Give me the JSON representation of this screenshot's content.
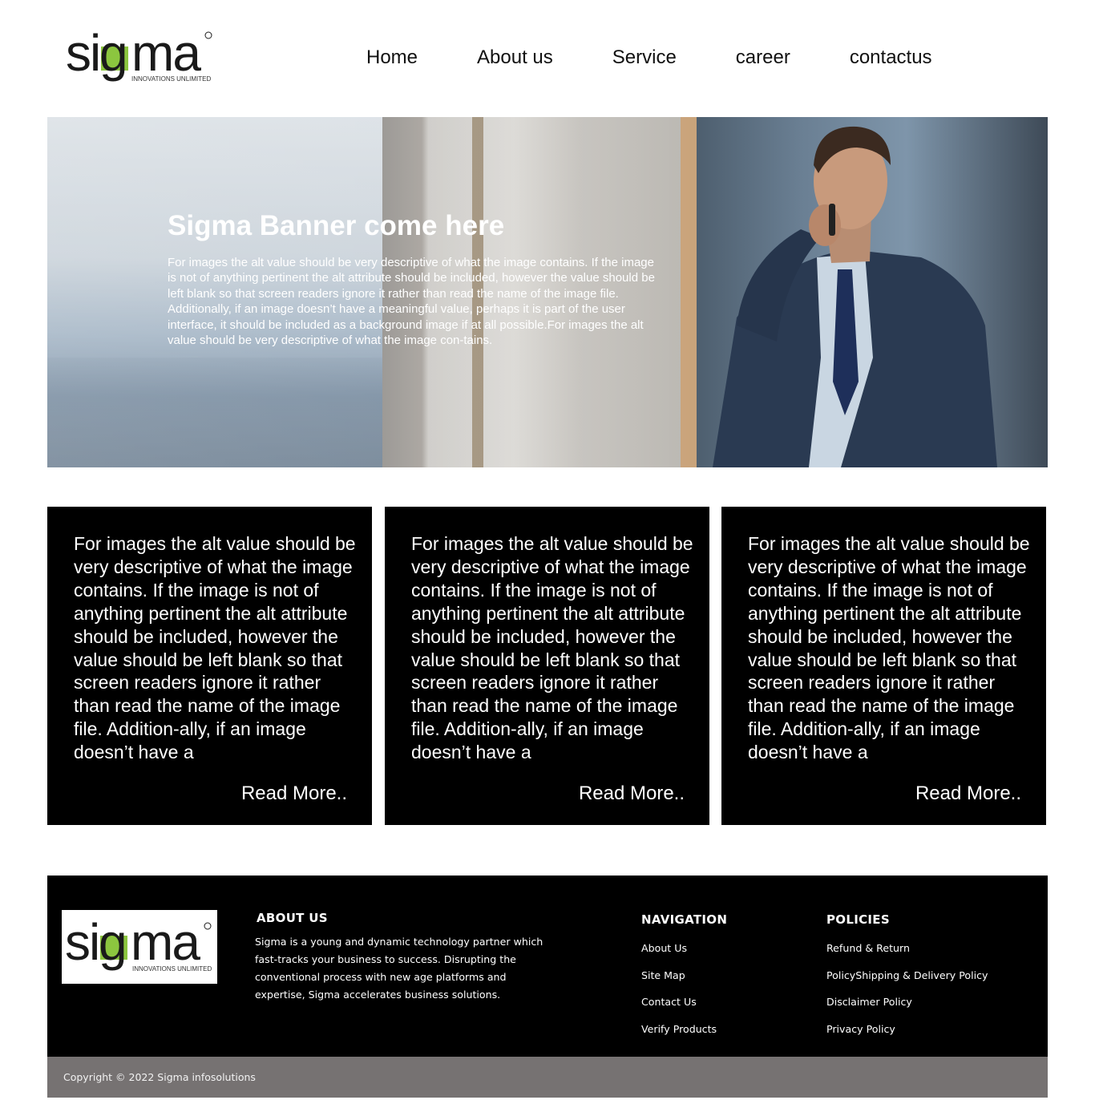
{
  "header": {
    "logo": {
      "brand": "sigma",
      "tagline": "INNOVATIONS UNLIMITED",
      "mark": "TM",
      "accent_color": "#8cc63f"
    },
    "nav": [
      {
        "label": "Home"
      },
      {
        "label": "About us"
      },
      {
        "label": "Service"
      },
      {
        "label": "career"
      },
      {
        "label": "contactus"
      }
    ]
  },
  "banner": {
    "title": "Sigma Banner come here",
    "text": "For images the alt value should be very descriptive of what the image contains. If the image is not of anything pertinent the alt attribute should be included, however the value should be left blank so that screen readers ignore it rather than read the name of the image file. Additionally, if an image doesn’t have a meaningful value, perhaps it is part of the user interface, it should be included as a background image if at all possible.For images the alt value should be very descriptive of what the image con-tains."
  },
  "cards": [
    {
      "text": "For images the alt value should be very descriptive of what the image contains. If the image is not of anything pertinent the alt attribute should be included, however the value should be left blank so that screen readers ignore it rather than read the name of the image file. Addition-ally, if an image doesn’t have a",
      "link": "Read More.."
    },
    {
      "text": "For images the alt value should be very descriptive of what the image contains. If the image is not of anything pertinent the alt attribute should be included, however the value should be left blank so that screen readers ignore it rather than read the name of the image file. Addition-ally, if an image doesn’t have a",
      "link": "Read More.."
    },
    {
      "text": "For images the alt value should be very descriptive of what the image contains. If the image is not of anything pertinent the alt attribute should be included, however the value should be left blank so that screen readers ignore it rather than read the name of the image file. Addition-ally, if an image doesn’t have a",
      "link": "Read More.."
    }
  ],
  "footer": {
    "about": {
      "heading": "ABOUT US",
      "text": "Sigma is a young and dynamic technology partner which fast-tracks your business to success. Disrupting the conventional process with new age platforms and expertise, Sigma accelerates business solutions."
    },
    "navigation": {
      "heading": "NAVIGATION",
      "links": [
        "About Us",
        "Site Map",
        "Contact Us",
        "Verify Products"
      ]
    },
    "policies": {
      "heading": "POLICIES",
      "links": [
        "Refund & Return",
        "PolicyShipping & Delivery Policy",
        "Disclaimer Policy",
        "Privacy Policy"
      ]
    },
    "copyright": "Copyright © 2022 Sigma infosolutions"
  },
  "colors": {
    "brand_green": "#8cc63f",
    "card_bg": "#000000",
    "footer_bg": "#000000",
    "copyright_bg": "#767272"
  }
}
